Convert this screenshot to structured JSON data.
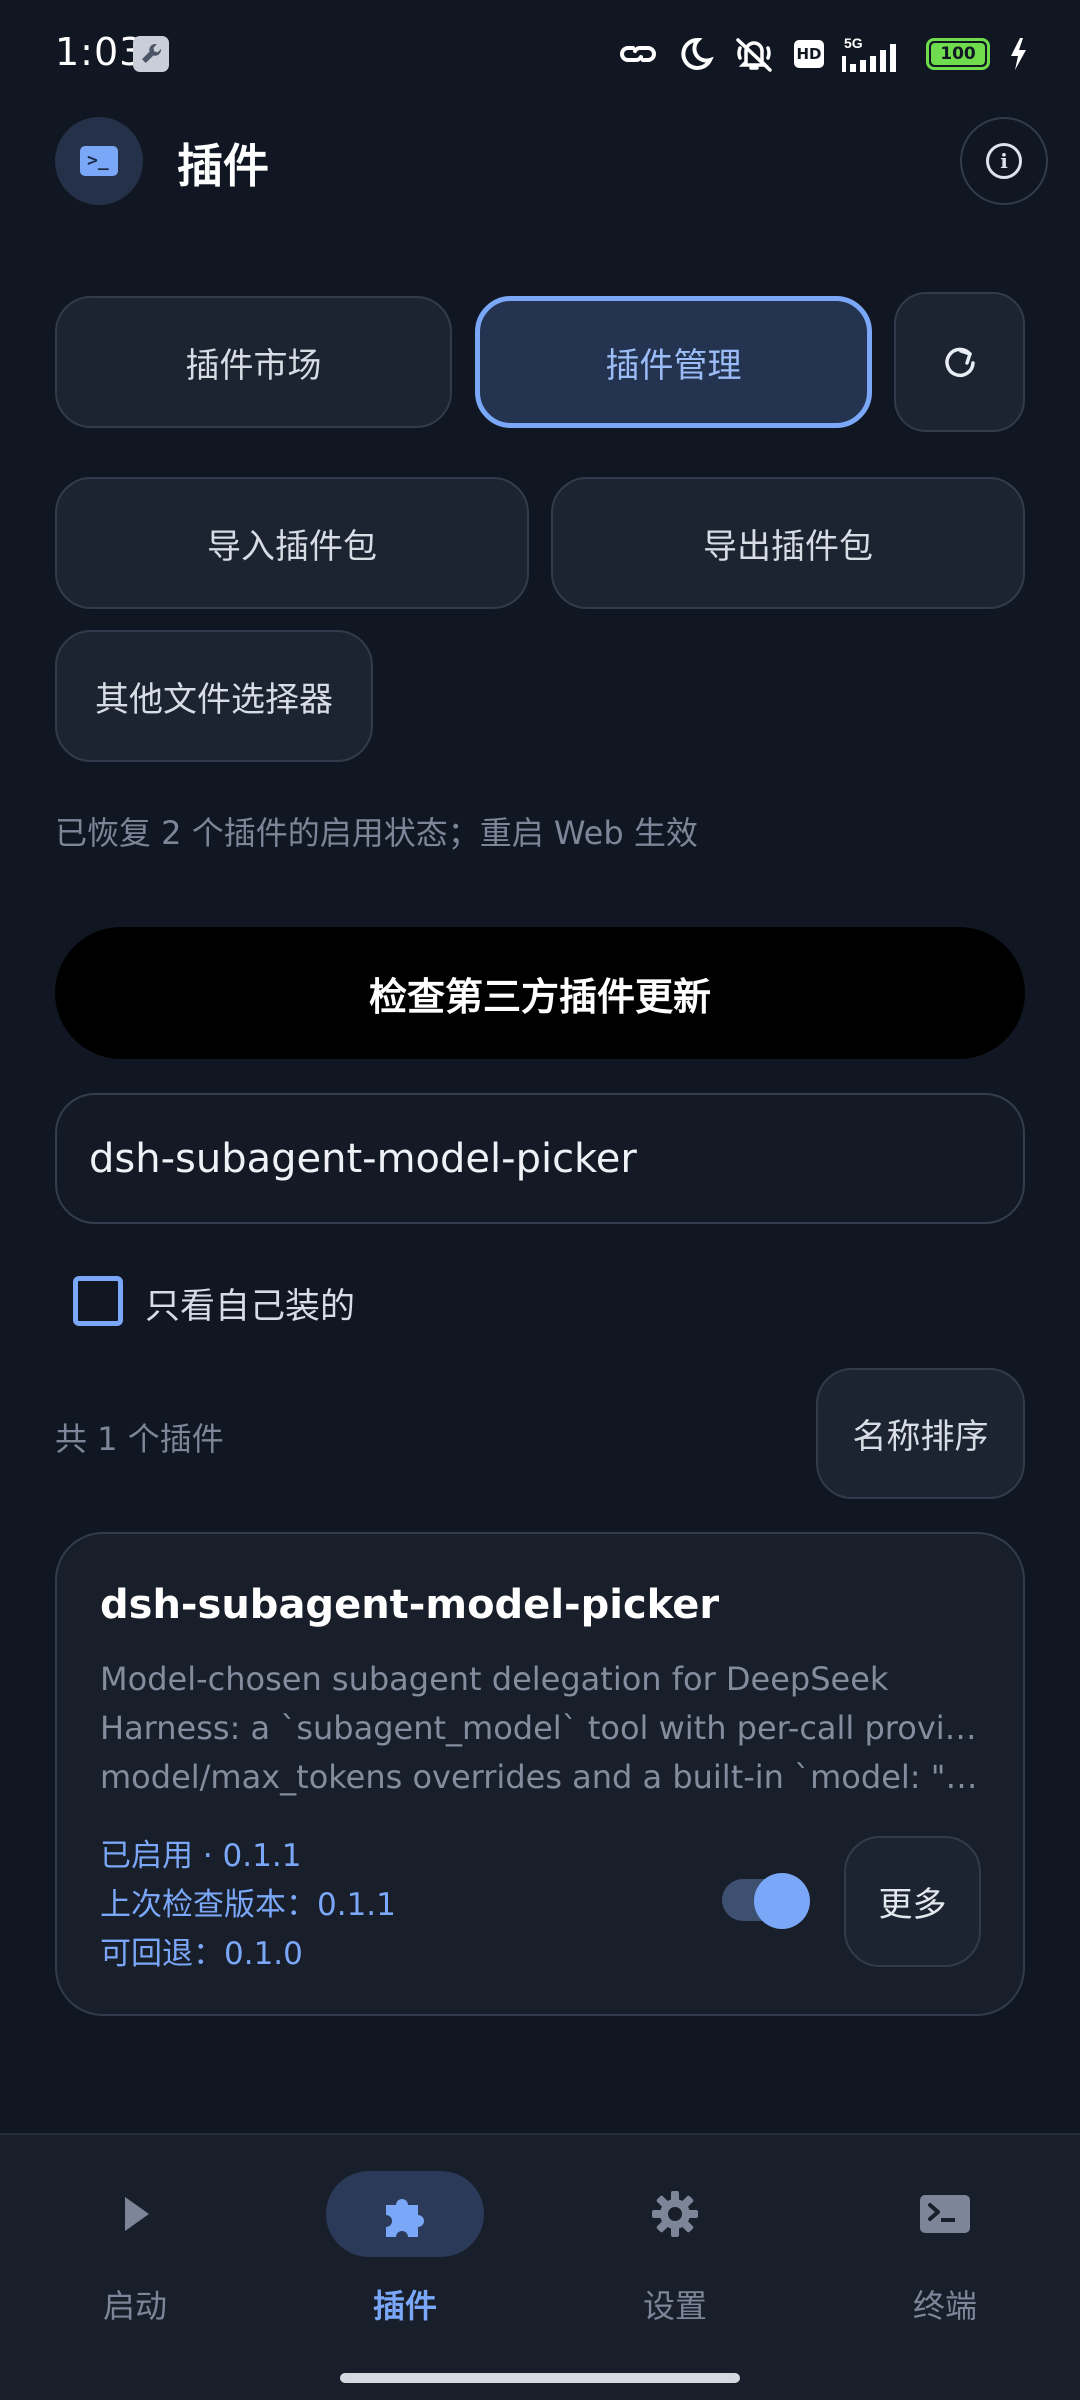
{
  "status_bar": {
    "time": "1:03",
    "network": "5G",
    "hd": "HD",
    "battery": "100"
  },
  "header": {
    "title": "插件",
    "app_icon": "terminal-icon",
    "info_icon": "info-icon"
  },
  "tabs": {
    "market": "插件市场",
    "manage": "插件管理",
    "refresh_icon": "refresh-icon"
  },
  "actions": {
    "import": "导入插件包",
    "export": "导出插件包",
    "other_picker": "其他文件选择器"
  },
  "status_message": "已恢复 2 个插件的启用状态；重启 Web 生效",
  "check_updates_label": "检查第三方插件更新",
  "search": {
    "value": "dsh-subagent-model-picker"
  },
  "filter": {
    "only_mine_label": "只看自己装的",
    "only_mine_checked": false
  },
  "list": {
    "count_label": "共 1 个插件",
    "sort_label": "名称排序"
  },
  "plugin": {
    "name": "dsh-subagent-model-picker",
    "description_lines": [
      "Model-chosen subagent delegation for DeepSeek",
      "Harness: a `subagent_model` tool with per-call provider/",
      "model/max_tokens overrides and a built-in `model: \"aut…"
    ],
    "status": "已启用 · 0.1.1",
    "last_checked": "上次检查版本：0.1.1",
    "rollback": "可回退：0.1.0",
    "enabled": true,
    "more_label": "更多"
  },
  "bottom_nav": {
    "items": [
      {
        "label": "启动",
        "icon": "play-icon"
      },
      {
        "label": "插件",
        "icon": "puzzle-icon"
      },
      {
        "label": "设置",
        "icon": "gear-icon"
      },
      {
        "label": "终端",
        "icon": "terminal-icon"
      }
    ],
    "active_index": 1
  },
  "colors": {
    "background": "#111722",
    "accent": "#7aa7f7",
    "surface": "#1c2331"
  }
}
